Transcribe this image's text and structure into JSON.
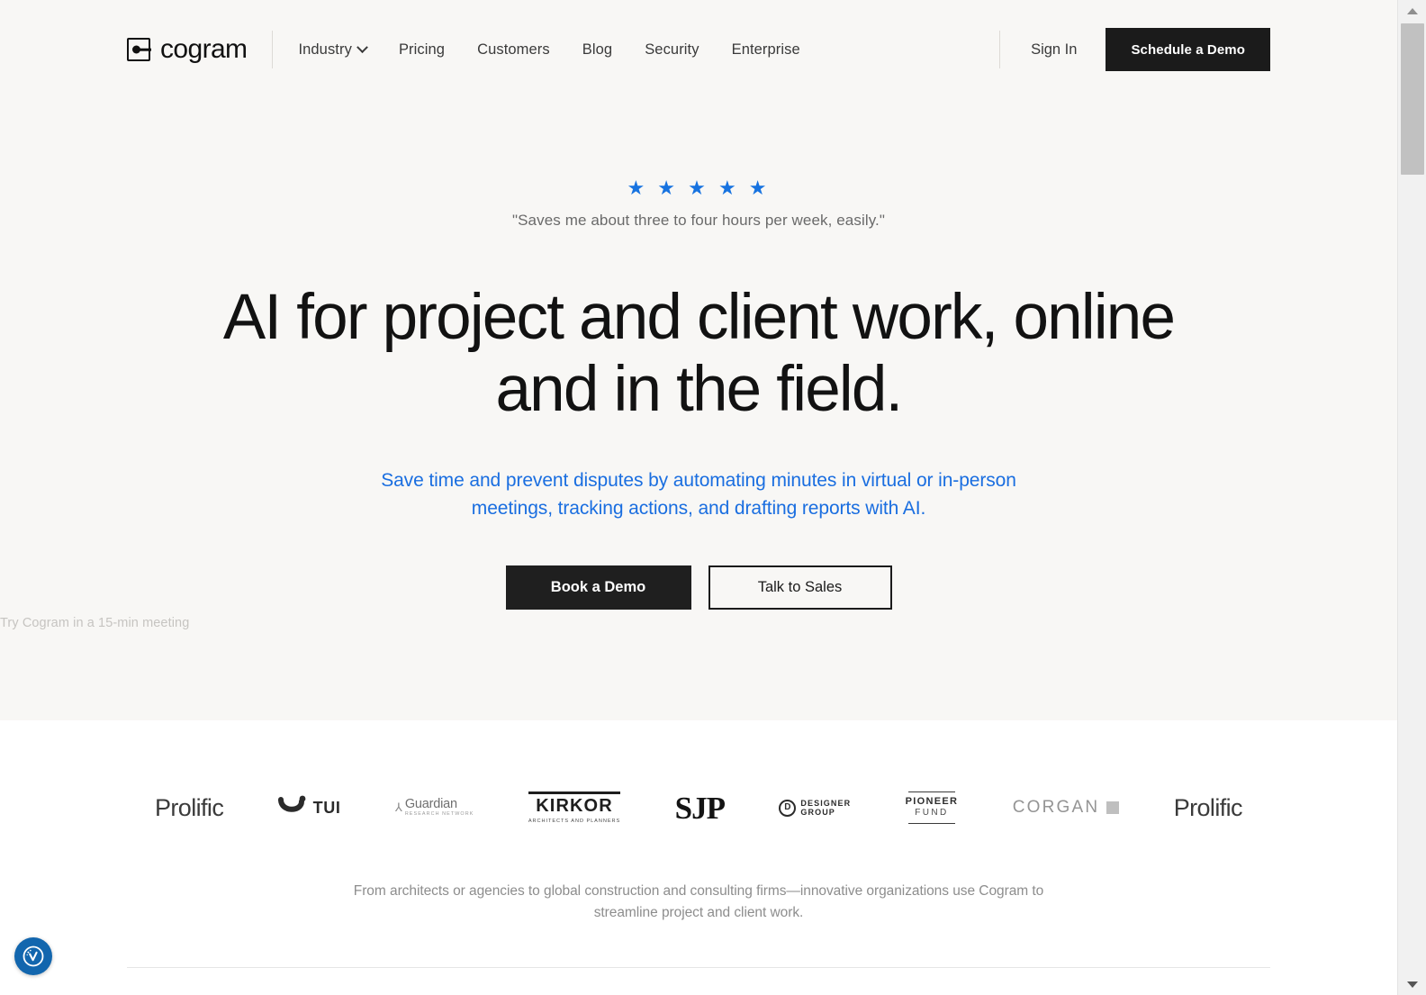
{
  "brand": {
    "name": "cogram",
    "mark": "cogram-logo-icon"
  },
  "nav": {
    "items": [
      {
        "label": "Industry",
        "has_chevron": true
      },
      {
        "label": "Pricing",
        "has_chevron": false
      },
      {
        "label": "Customers",
        "has_chevron": false
      },
      {
        "label": "Blog",
        "has_chevron": false
      },
      {
        "label": "Security",
        "has_chevron": false
      },
      {
        "label": "Enterprise",
        "has_chevron": false
      }
    ],
    "sign_in": "Sign In",
    "cta": "Schedule a Demo"
  },
  "hero": {
    "stars": "★ ★ ★ ★ ★",
    "star_count": 5,
    "star_color": "#1773E0",
    "quote": "\"Saves me about three to four hours per week, easily.\"",
    "headline": "AI for project and client work, online and in the field.",
    "subhead": "Save time and prevent disputes by automating minutes in virtual or in-person meetings, tracking actions, and drafting reports with AI.",
    "subhead_color": "#1A6EE0",
    "primary_cta": "Book a Demo",
    "secondary_cta": "Talk to Sales",
    "cta_note": "Try Cogram in a 15-min meeting"
  },
  "logos": {
    "items": [
      {
        "id": "prolific",
        "name": "Prolific"
      },
      {
        "id": "tui",
        "name": "TUI"
      },
      {
        "id": "guardian",
        "name": "Guardian",
        "sub": "RESEARCH NETWORK"
      },
      {
        "id": "kirkor",
        "name": "KIRKOR",
        "sub": "ARCHITECTS AND PLANNERS"
      },
      {
        "id": "sjp",
        "name": "SJP"
      },
      {
        "id": "designer-group",
        "name": "DESIGNER",
        "sub": "GROUP",
        "mark": "D"
      },
      {
        "id": "pioneer-fund",
        "name": "PIONEER",
        "sub": "FUND"
      },
      {
        "id": "corgan",
        "name": "CORGAN"
      },
      {
        "id": "prolific-2",
        "name": "Prolific"
      }
    ],
    "caption": "From architects or agencies to global construction and consulting firms—innovative organizations use Cogram to streamline project and client work."
  },
  "widgets": {
    "accessibility_label": "accessibility-widget"
  }
}
